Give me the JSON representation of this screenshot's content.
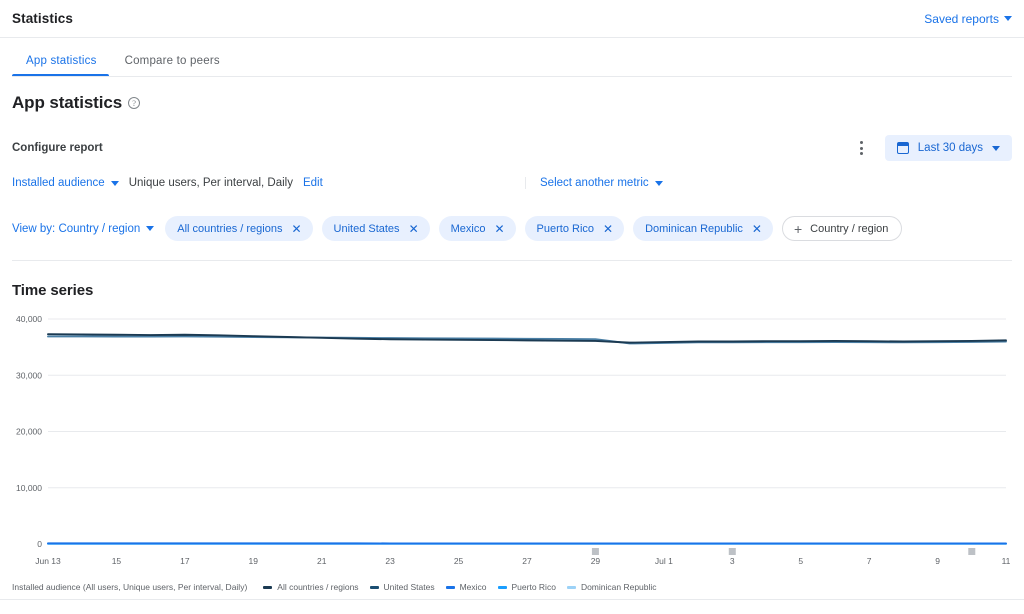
{
  "header": {
    "title": "Statistics",
    "saved_reports_label": "Saved reports",
    "saved_reports_icon": "chevron-down-icon"
  },
  "tabs": [
    {
      "label": "App statistics",
      "active": true
    },
    {
      "label": "Compare to peers",
      "active": false
    }
  ],
  "page": {
    "title": "App statistics",
    "help_icon": "help-circle-icon"
  },
  "configure": {
    "label": "Configure report",
    "kebab_icon": "more-vert-icon",
    "date_range": {
      "icon": "calendar-icon",
      "label": "Last 30 days",
      "caret_icon": "chevron-down-icon"
    }
  },
  "metric": {
    "audience_label": "Installed audience",
    "audience_caret": "chevron-down-icon",
    "description": "Unique users, Per interval, Daily",
    "edit_label": "Edit",
    "select_metric_label": "Select another metric",
    "select_metric_caret": "chevron-down-icon"
  },
  "dimension": {
    "view_by_label": "View by: Country / region",
    "view_by_caret": "chevron-down-icon",
    "chips": [
      {
        "label": "All countries / regions",
        "remove_icon": "close-icon"
      },
      {
        "label": "United States",
        "remove_icon": "close-icon"
      },
      {
        "label": "Mexico",
        "remove_icon": "close-icon"
      },
      {
        "label": "Puerto Rico",
        "remove_icon": "close-icon"
      },
      {
        "label": "Dominican Republic",
        "remove_icon": "close-icon"
      }
    ],
    "add_chip": {
      "plus_icon": "plus-icon",
      "label": "Country / region"
    }
  },
  "chart_section": {
    "title": "Time series",
    "legend_title": "Installed audience (All users, Unique users, Per interval, Daily)"
  },
  "chart_data": {
    "type": "line",
    "title": "Time series",
    "xlabel": "",
    "ylabel": "",
    "ylim": [
      0,
      40000
    ],
    "yticks": [
      0,
      10000,
      20000,
      30000,
      40000
    ],
    "ytick_labels": [
      "0",
      "10,000",
      "20,000",
      "30,000",
      "40,000"
    ],
    "grid": true,
    "legend_position": "bottom",
    "x": [
      "Jun 13",
      "Jun 14",
      "Jun 15",
      "Jun 16",
      "Jun 17",
      "Jun 18",
      "Jun 19",
      "Jun 20",
      "Jun 21",
      "Jun 22",
      "Jun 23",
      "Jun 24",
      "Jun 25",
      "Jun 26",
      "Jun 27",
      "Jun 28",
      "Jun 29",
      "Jun 30",
      "Jul 1",
      "Jul 2",
      "Jul 3",
      "Jul 4",
      "Jul 5",
      "Jul 6",
      "Jul 7",
      "Jul 8",
      "Jul 9",
      "Jul 10",
      "Jul 11"
    ],
    "xtick_labels": [
      "Jun 13",
      "15",
      "17",
      "19",
      "21",
      "23",
      "25",
      "27",
      "29",
      "Jul 1",
      "3",
      "5",
      "7",
      "9",
      "11"
    ],
    "xtick_indices": [
      0,
      2,
      4,
      6,
      8,
      10,
      12,
      14,
      16,
      18,
      20,
      22,
      24,
      26,
      28
    ],
    "series": [
      {
        "name": "All countries / regions",
        "color": "#1b3a52",
        "values": [
          37300,
          37250,
          37200,
          37150,
          37200,
          37100,
          36950,
          36800,
          36650,
          36500,
          36400,
          36350,
          36300,
          36250,
          36200,
          36150,
          36100,
          35800,
          35900,
          36000,
          36000,
          36050,
          36050,
          36100,
          36050,
          36000,
          36050,
          36100,
          36200
        ]
      },
      {
        "name": "United States",
        "color": "#4a7fa5",
        "values": [
          36900,
          36900,
          36880,
          36870,
          36900,
          36850,
          36800,
          36750,
          36700,
          36650,
          36600,
          36570,
          36540,
          36510,
          36480,
          36450,
          36420,
          35650,
          35750,
          35850,
          35850,
          35880,
          35880,
          35900,
          35880,
          35850,
          35880,
          35920,
          36000
        ]
      },
      {
        "name": "Mexico",
        "color": "#1a73e8",
        "values": [
          120,
          118,
          120,
          115,
          118,
          116,
          114,
          112,
          110,
          110,
          108,
          108,
          106,
          106,
          105,
          104,
          104,
          102,
          103,
          104,
          104,
          105,
          105,
          106,
          105,
          104,
          105,
          106,
          108
        ]
      },
      {
        "name": "Puerto Rico",
        "color": "#1a9eff",
        "values": [
          60,
          59,
          60,
          58,
          59,
          58,
          57,
          56,
          56,
          55,
          55,
          54,
          54,
          53,
          53,
          52,
          52,
          51,
          52,
          52,
          52,
          53,
          53,
          53,
          53,
          52,
          53,
          53,
          54
        ]
      },
      {
        "name": "Dominican Republic",
        "color": "#9cd2f7",
        "values": [
          40,
          40,
          39,
          39,
          40,
          39,
          38,
          38,
          37,
          37,
          37,
          36,
          36,
          36,
          35,
          35,
          35,
          34,
          35,
          35,
          35,
          35,
          35,
          36,
          35,
          35,
          35,
          36,
          36
        ]
      }
    ],
    "markers": [
      {
        "x_index": 16,
        "color": "#bdc1c6"
      },
      {
        "x_index": 20,
        "color": "#bdc1c6"
      },
      {
        "x_index": 27,
        "color": "#bdc1c6"
      }
    ]
  }
}
